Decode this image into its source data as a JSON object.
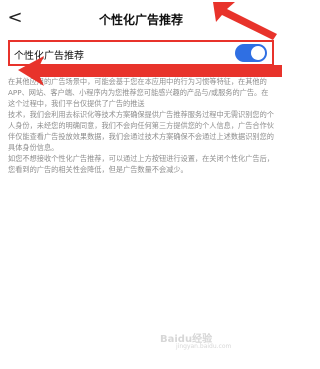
{
  "navbar": {
    "back_glyph": "<",
    "title": "个性化广告推荐"
  },
  "setting": {
    "label": "个性化广告推荐",
    "toggle_on": true,
    "toggle_color": "#2f6fe3"
  },
  "description": [
    "在其他应用的广告场景中，可能会基于您在本应用中的行为习惯等特征，在其他的APP、网站、客户端、小程序内为您推荐您可能感兴趣的产品与/或服务的广告。在这个过程中，我们平台仅提供了广告的推送",
    "技术，我们会利用去标识化等技术方案确保提供广告推荐服务过程中无需识别您的个人身份，未经您的明确同意，我们不会向任何第三方提供您的个人信息，广告合作伙伴仅能查看广告投放效果数据，我们会通过技术方案确保不会通过上述数据识别您的具体身份信息。",
    "如您不想接收个性化广告推荐，可以通过上方按钮进行设置，在关闭个性化广告后，您看到的广告的相关性会降低，但是广告数量不会减少。"
  ],
  "watermark": {
    "brand": "Baidu经验",
    "sub": "jingyan.baidu.com"
  },
  "annotation_color": "#e8332b"
}
